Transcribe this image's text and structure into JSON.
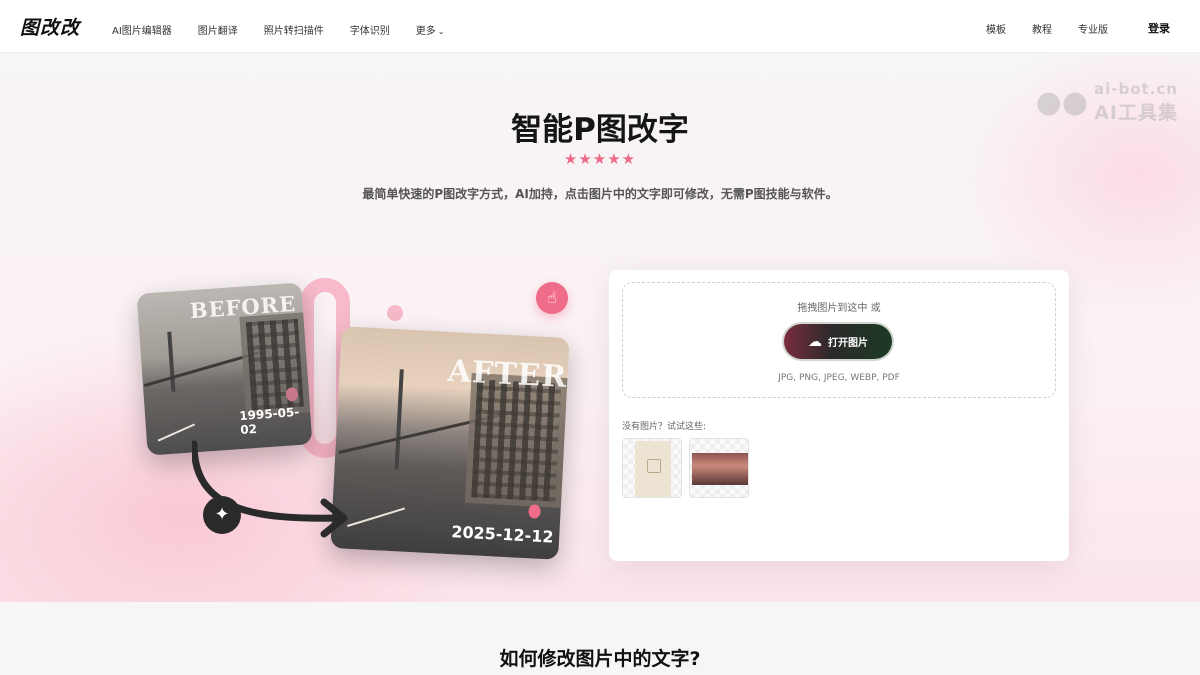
{
  "nav": {
    "logo": "图改改",
    "links": [
      "AI图片编辑器",
      "图片翻译",
      "照片转扫描件",
      "字体识别",
      "更多"
    ],
    "more_chevron": "⌄",
    "right_links": [
      "模板",
      "教程",
      "专业版"
    ],
    "login": "登录"
  },
  "watermark": {
    "top": "ai-bot.cn",
    "bottom": "AI工具集"
  },
  "hero": {
    "title": "智能P图改字",
    "stars": "★★★★★",
    "subtitle": "最简单快速的P图改字方式，AI加持，点击图片中的文字即可修改，无需P图技能与软件。"
  },
  "illustration": {
    "before_label": "BEFORE",
    "before_date": "1995-05-02",
    "after_label": "AFTER",
    "after_date": "2025-12-12"
  },
  "upload": {
    "drop_text": "拖拽图片到这中 或",
    "button_label": "打开图片",
    "formats": "JPG, PNG, JPEG, WEBP, PDF",
    "try_label": "没有图片？试试这些:"
  },
  "section": {
    "title": "如何修改图片中的文字?"
  },
  "colors": {
    "accent": "#ee6a86",
    "button_dark": "#2a2a2a"
  }
}
